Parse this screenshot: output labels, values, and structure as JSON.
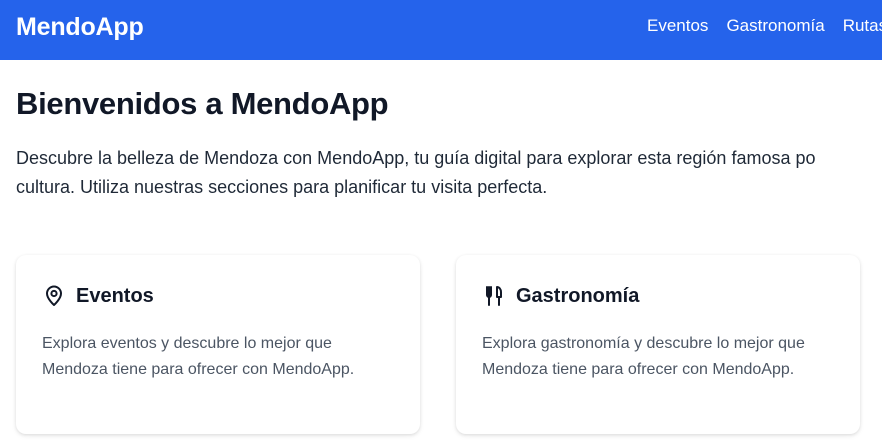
{
  "header": {
    "brand": "MendoApp",
    "nav": [
      {
        "label": "Eventos"
      },
      {
        "label": "Gastronomía"
      },
      {
        "label": "Rutas"
      }
    ]
  },
  "main": {
    "title": "Bienvenidos a MendoApp",
    "intro_line1": "Descubre la belleza de Mendoza con MendoApp, tu guía digital para explorar esta región famosa po",
    "intro_line2": "cultura. Utiliza nuestras secciones para planificar tu visita perfecta."
  },
  "cards": [
    {
      "title": "Eventos",
      "icon": "map-pin-icon",
      "description": "Explora eventos y descubre lo mejor que Mendoza tiene para ofrecer con MendoApp."
    },
    {
      "title": "Gastronomía",
      "icon": "utensils-icon",
      "description": "Explora gastronomía y descubre lo mejor que Mendoza tiene para ofrecer con MendoApp."
    }
  ],
  "colors": {
    "header_bg": "#2563eb",
    "header_text": "#ffffff",
    "body_text": "#1f2937",
    "muted_text": "#4b5563"
  }
}
